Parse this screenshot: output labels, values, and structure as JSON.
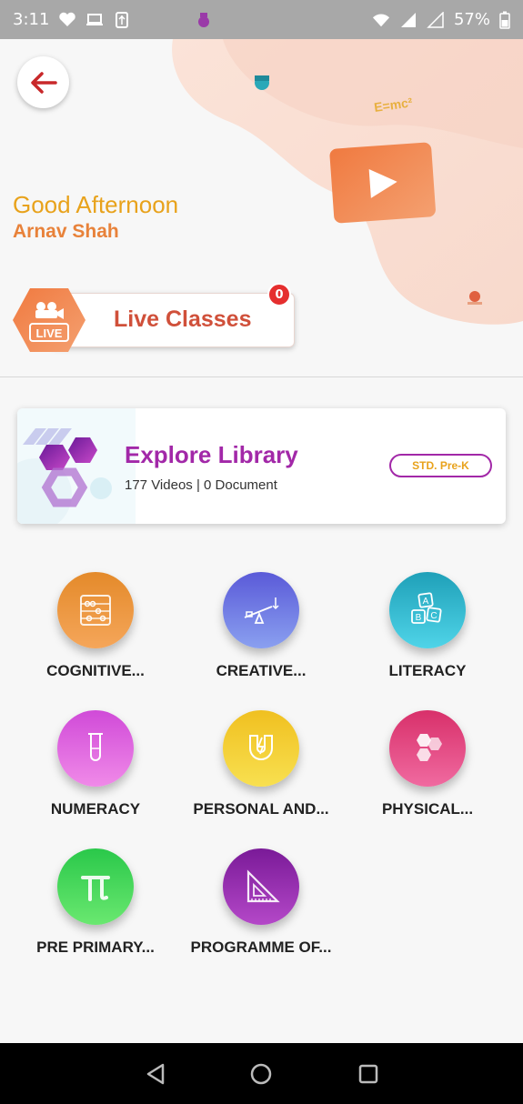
{
  "status_bar": {
    "time": "3:11",
    "battery": "57%",
    "icons_left": [
      "heart-icon",
      "laptop-icon",
      "usb-icon"
    ],
    "icons_right": [
      "wifi-icon",
      "signal-icon",
      "signal-icon",
      "battery-icon"
    ]
  },
  "header": {
    "greeting": "Good Afternoon",
    "username": "Arnav Shah",
    "formula": "E=mc²"
  },
  "live_classes": {
    "label": "Live Classes",
    "badge_count": "0",
    "icon_text": "LIVE"
  },
  "library": {
    "title": "Explore Library",
    "subtitle": "177 Videos | 0 Document",
    "standard": "STD. Pre-K"
  },
  "categories": [
    {
      "label": "COGNITIVE...",
      "icon": "abacus-icon",
      "color_top": "#e48a2a",
      "color_bottom": "#f5a65a"
    },
    {
      "label": "CREATIVE...",
      "icon": "seesaw-icon",
      "color_top": "#5a5ad8",
      "color_bottom": "#8aa0f0"
    },
    {
      "label": "LITERACY",
      "icon": "abc-blocks-icon",
      "color_top": "#1fa0b8",
      "color_bottom": "#4fd4e8"
    },
    {
      "label": "NUMERACY",
      "icon": "test-tube-icon",
      "color_top": "#d04ad8",
      "color_bottom": "#f08ae8"
    },
    {
      "label": "PERSONAL AND...",
      "icon": "magnet-icon",
      "color_top": "#f0c020",
      "color_bottom": "#f8e050"
    },
    {
      "label": "PHYSICAL...",
      "icon": "hexagons-icon",
      "color_top": "#d8306a",
      "color_bottom": "#f06aa0"
    },
    {
      "label": "PRE PRIMARY...",
      "icon": "pi-icon",
      "color_top": "#2ac84a",
      "color_bottom": "#6ae870"
    },
    {
      "label": "PROGRAMME OF...",
      "icon": "set-square-icon",
      "color_top": "#7a1a98",
      "color_bottom": "#b448c8"
    }
  ],
  "colors": {
    "accent_orange": "#e8823a",
    "accent_purple": "#a228a8",
    "greeting_yellow": "#e8a21b",
    "live_red": "#d0503a"
  }
}
